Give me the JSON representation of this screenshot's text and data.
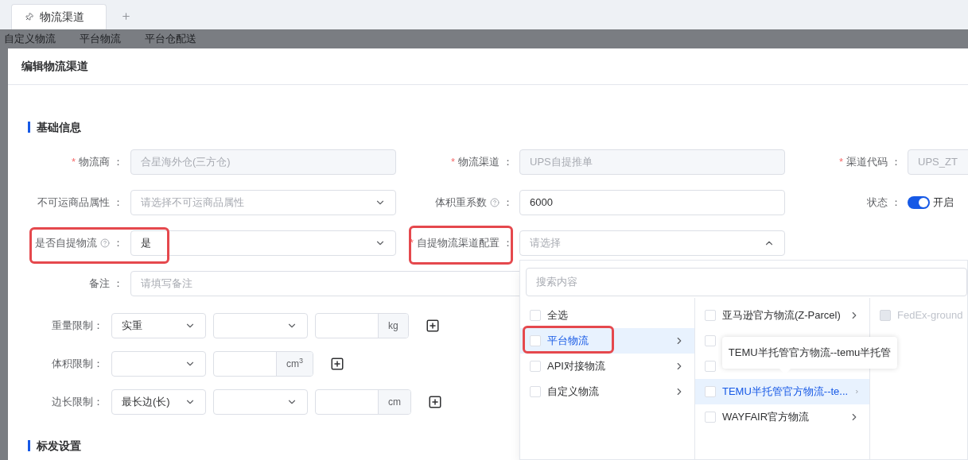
{
  "tabs": [
    {
      "label": "物流渠道",
      "selected": true
    }
  ],
  "background_tabs": [
    "自定义物流",
    "平台物流",
    "平台仓配送"
  ],
  "dialog": {
    "title": "编辑物流渠道",
    "sections": [
      {
        "title": "基础信息",
        "rows": [
          [
            {
              "kind": "input",
              "label": "物流商",
              "colon": "：",
              "required_mark": "*",
              "disabled": true,
              "value": "合星海外仓(三方仓)"
            },
            {
              "kind": "input",
              "label": "物流渠道",
              "colon": "：",
              "required_mark": "*",
              "disabled": true,
              "value": "UPS自提推单"
            },
            {
              "kind": "input",
              "label": "渠道代码",
              "colon": "：",
              "required_mark": "*",
              "disabled": true,
              "value": "UPS_ZT"
            }
          ],
          [
            {
              "kind": "select",
              "label": "不可运商品属性",
              "colon": "：",
              "open": false,
              "placeholder": "请选择不可运商品属性"
            },
            {
              "kind": "input",
              "label": "体积重系数",
              "colon": "：",
              "help": true,
              "disabled": false,
              "value": "6000"
            },
            {
              "kind": "switch",
              "label": "状态",
              "colon": "：",
              "on": true,
              "text": "开启"
            }
          ],
          [
            {
              "kind": "select",
              "label": "是否自提物流",
              "colon": "：",
              "help": true,
              "highlighted": true,
              "open": false,
              "value": "是"
            },
            {
              "kind": "select",
              "label": "自提物流渠道配置",
              "colon": "：",
              "required_mark": "*",
              "highlighted": true,
              "open": true,
              "placeholder": "请选择"
            }
          ],
          [
            {
              "kind": "wide_input",
              "label": "备注",
              "colon": "：",
              "placeholder": "请填写备注"
            }
          ]
        ],
        "limits": [
          {
            "label": "重量限制：",
            "controls": [
              {
                "kind": "select",
                "value": "实重"
              },
              {
                "kind": "select"
              },
              {
                "kind": "unit_input",
                "unit": "kg"
              }
            ]
          },
          {
            "label": "体积限制：",
            "controls": [
              {
                "kind": "select"
              },
              {
                "kind": "unit_input",
                "unit": "cm$^{3}$"
              }
            ]
          },
          {
            "label": "边长限制：",
            "controls": [
              {
                "kind": "select",
                "value": "最长边(长)"
              },
              {
                "kind": "select"
              },
              {
                "kind": "unit_input",
                "unit": "cm"
              }
            ]
          }
        ]
      },
      {
        "title": "标发设置"
      }
    ]
  },
  "dropdown": {
    "search": {
      "placeholder": "搜索内容"
    },
    "columns": [
      [
        {
          "label": "全选",
          "checked": false,
          "selected": false,
          "disabled": false
        },
        {
          "label": "平台物流",
          "checked": false,
          "selected": true,
          "disabled": false,
          "has_children": true,
          "highlighted": true
        },
        {
          "label": "API对接物流",
          "checked": false,
          "selected": false,
          "disabled": false,
          "has_children": true
        },
        {
          "label": "自定义物流",
          "checked": false,
          "selected": false,
          "disabled": false,
          "has_children": true
        }
      ],
      [
        {
          "label": "亚马逊官方物流(Z-Parcel)",
          "checked": false,
          "selected": false,
          "disabled": false,
          "has_children": true
        },
        {
          "checked": false,
          "selected": false,
          "disabled": false
        },
        {
          "checked": false,
          "selected": false,
          "disabled": false
        },
        {
          "label": "TEMU半托管官方物流--te...",
          "checked": false,
          "selected": true,
          "disabled": false,
          "has_children": true
        },
        {
          "label": "WAYFAIR官方物流",
          "checked": false,
          "selected": false,
          "disabled": false,
          "has_children": true
        }
      ],
      [
        {
          "label": "FedEx-ground",
          "checked": false,
          "selected": false,
          "disabled": true
        }
      ]
    ],
    "tooltip": "TEMU半托管官方物流--temu半托管"
  }
}
